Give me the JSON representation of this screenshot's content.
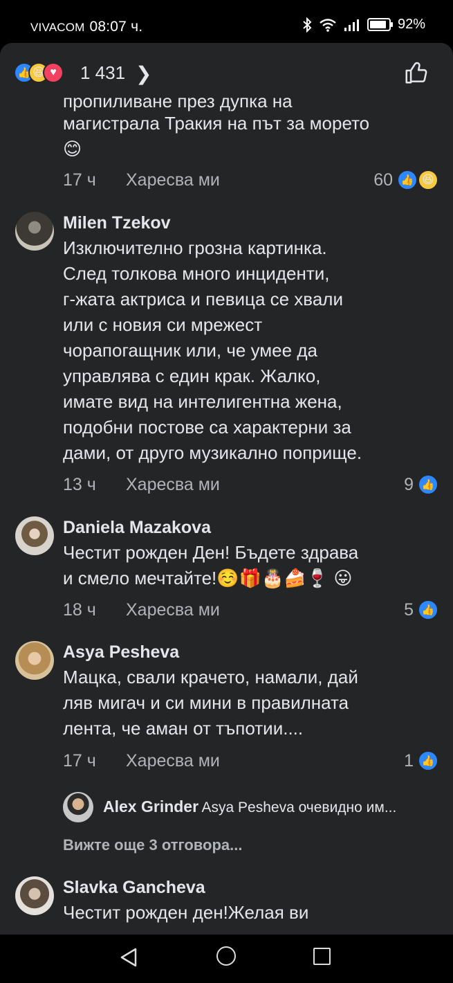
{
  "status_bar": {
    "carrier": "VIVACOM",
    "time": "08:07 ч.",
    "battery": "92%",
    "icons": [
      "bluetooth-icon",
      "wifi-icon",
      "signal-icon",
      "battery-icon"
    ]
  },
  "reactions_header": {
    "count": "1 431",
    "reaction_types": [
      "like",
      "haha",
      "love"
    ]
  },
  "comments": [
    {
      "lines": [
        "пропиливане през дупка на",
        "магистрала Тракия на път за морето",
        "😊"
      ],
      "time": "17 ч",
      "like_label": "Харесва ми",
      "reaction_count": "60",
      "reactions": [
        "like",
        "haha"
      ]
    },
    {
      "name": "Milen Tzekov",
      "lines": [
        "Изключително грозна картинка.",
        "След толкова много инциденти,",
        "г-жата актриса и певица се хвали",
        "или с новия си мрежест",
        "чорапогащник или, че умее да",
        "управлява с един крак. Жалко,",
        "имате вид на интелигентна жена,",
        "подобни постове са характерни за",
        "дами, от друго музикално поприще."
      ],
      "time": "13 ч",
      "like_label": "Харесва ми",
      "reaction_count": "9",
      "reactions": [
        "like"
      ]
    },
    {
      "name": "Daniela Mazakova",
      "lines": [
        "Честит рожден Ден! Бъдете здрава",
        "и смело мечтайте!☺️🎁🎂🍰🍷 😛"
      ],
      "time": "18 ч",
      "like_label": "Харесва ми",
      "reaction_count": "5",
      "reactions": [
        "like"
      ]
    },
    {
      "name": "Asya Pesheva",
      "lines": [
        "Мацка, свали крачето, намали, дай",
        "ляв мигач и си мини в правилната",
        "лента, че аман от тъпотии...."
      ],
      "time": "17 ч",
      "like_label": "Харесва ми",
      "reaction_count": "1",
      "reactions": [
        "like"
      ],
      "reply_preview": {
        "name": "Alex Grinder",
        "text": "Asya Pesheva очевидно им..."
      },
      "view_more": "Вижте още 3 отговора..."
    },
    {
      "name": "Slavka Gancheva",
      "lines": [
        "Честит рожден ден!Желая ви"
      ]
    }
  ],
  "colors": {
    "background": "#242526",
    "text": "#e4e6eb",
    "secondary_text": "#b0b3b8",
    "like_blue": "#2d88ff",
    "haha_yellow": "#f7c93e",
    "love_red": "#f3425f"
  },
  "nav": {
    "icons": [
      "back-icon",
      "home-icon",
      "recent-apps-icon"
    ]
  }
}
